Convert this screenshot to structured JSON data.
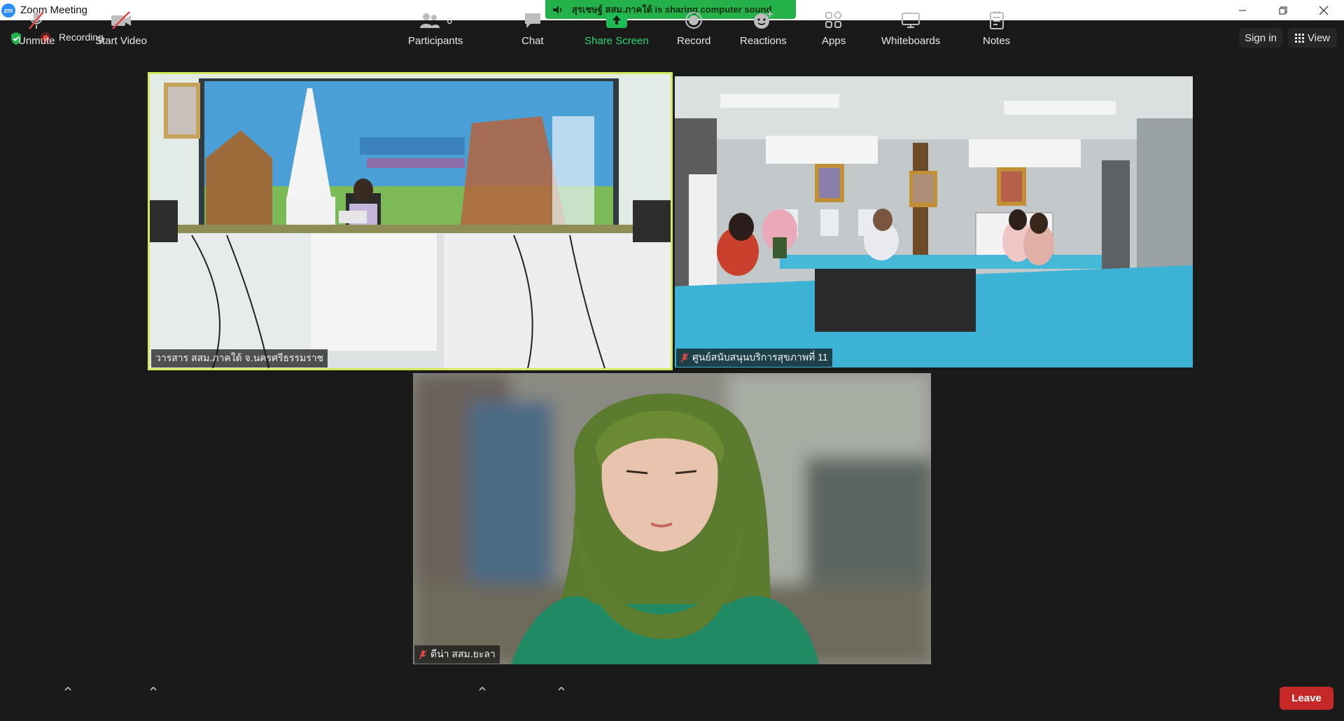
{
  "window": {
    "title": "Zoom Meeting",
    "app_icon_text": "zm"
  },
  "share_banner": {
    "text": "สุรเชษฐ์ สสม.ภาคใต้ is sharing computer sound"
  },
  "top_bar": {
    "recording_label": "Recording",
    "sign_in_label": "Sign in",
    "view_label": "View"
  },
  "tiles": [
    {
      "name": "วารสาร สสม.ภาคใต้ จ.นครศรีธรรมราช",
      "muted": false,
      "active_speaker": true
    },
    {
      "name": "ศูนย์สนับสนุนบริการสุขภาพที่ 11",
      "muted": true,
      "active_speaker": false
    },
    {
      "name": "ดีน่า สสม.ยะลา",
      "muted": true,
      "active_speaker": false
    }
  ],
  "toolbar": {
    "unmute_label": "Unmute",
    "start_video_label": "Start Video",
    "participants_label": "Participants",
    "participants_count": "6",
    "chat_label": "Chat",
    "share_screen_label": "Share Screen",
    "record_label": "Record",
    "reactions_label": "Reactions",
    "apps_label": "Apps",
    "whiteboards_label": "Whiteboards",
    "notes_label": "Notes",
    "leave_label": "Leave"
  },
  "colors": {
    "background": "#1a1a1a",
    "share_banner": "#25b14a",
    "active_speaker_border": "#d4ea5a",
    "share_screen_green": "#2ed573",
    "leave_red": "#c62828"
  }
}
